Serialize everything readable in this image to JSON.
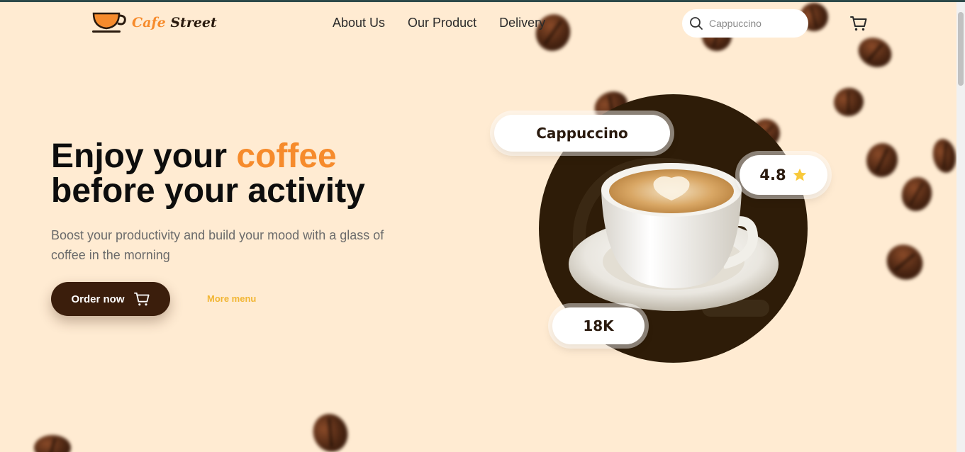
{
  "brand": {
    "name_part1": "Cafe",
    "name_part2": "Street"
  },
  "nav": {
    "items": [
      {
        "label": "About Us"
      },
      {
        "label": "Our Product"
      },
      {
        "label": "Delivery"
      }
    ]
  },
  "search": {
    "placeholder": "Cappuccino"
  },
  "hero": {
    "title_part1": "Enjoy your ",
    "title_accent": "coffee",
    "title_part2": "before your activity",
    "subtitle": "Boost your productivity and build your mood with a glass of coffee in the morning",
    "order_button": "Order now",
    "more_link": "More menu"
  },
  "product": {
    "name": "Cappuccino",
    "rating": "4.8",
    "count": "18K"
  },
  "colors": {
    "background": "#ffebd2",
    "accent": "#f68b2c",
    "dark_brown": "#3b1e0c",
    "link_yellow": "#f2b634",
    "star": "#f8c93a"
  },
  "icons": [
    "logo-cup-icon",
    "search-icon",
    "cart-icon",
    "star-icon",
    "coffee-bean"
  ]
}
